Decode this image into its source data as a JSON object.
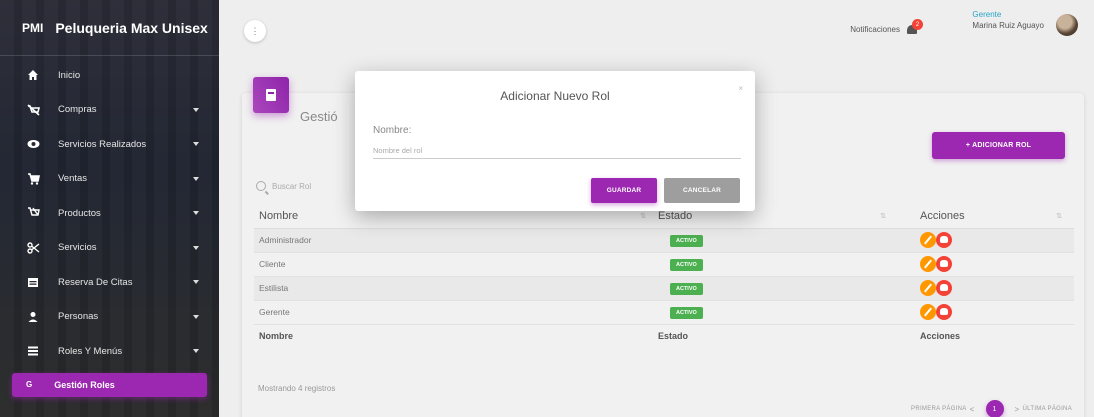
{
  "sidebar": {
    "brand_mini": "PMI",
    "brand_name": "Peluqueria Max Unisex",
    "items": [
      {
        "label": "Inicio",
        "icon": "home-icon",
        "caret": false
      },
      {
        "label": "Compras",
        "icon": "cart-off-icon",
        "caret": true
      },
      {
        "label": "Servicios Realizados",
        "icon": "eye-icon",
        "caret": true
      },
      {
        "label": "Ventas",
        "icon": "shopping-cart-icon",
        "caret": true
      },
      {
        "label": "Productos",
        "icon": "products-icon",
        "caret": true
      },
      {
        "label": "Servicios",
        "icon": "scissors-icon",
        "caret": true
      },
      {
        "label": "Reserva De Citas",
        "icon": "calendar-icon",
        "caret": true
      },
      {
        "label": "Personas",
        "icon": "person-icon",
        "caret": true
      },
      {
        "label": "Roles Y Menús",
        "icon": "list-icon",
        "caret": true
      }
    ],
    "active_item": {
      "mini": "G",
      "label": "Gestión Roles"
    }
  },
  "topbar": {
    "menu_button": "⋮",
    "notifications_label": "Notificaciones",
    "notifications_count": "2",
    "user_role": "Gerente",
    "user_name": "Marina Ruiz Aguayo"
  },
  "card": {
    "title": "Gestió",
    "add_button": "+ ADICIONAR ROL",
    "search_placeholder": "Buscar Rol",
    "columns": [
      "Nombre",
      "Estado",
      "Acciones"
    ],
    "rows": [
      {
        "name": "Administrador",
        "state": "ACTIVO"
      },
      {
        "name": "Cliente",
        "state": "ACTIVO"
      },
      {
        "name": "Estilista",
        "state": "ACTIVO"
      },
      {
        "name": "Gerente",
        "state": "ACTIVO"
      }
    ],
    "footer_columns": [
      "Nombre",
      "Estado",
      "Acciones"
    ],
    "records_text": "Mostrando 4 registros",
    "pager": {
      "first": "PRIMERA PÁGINA",
      "prev": "<",
      "current": "1",
      "next": ">",
      "last": "ÚLTIMA PÁGINA"
    }
  },
  "modal": {
    "title": "Adicionar Nuevo Rol",
    "close": "×",
    "field_label": "Nombre:",
    "field_placeholder": "Nombre del rol",
    "field_value": "",
    "save_button": "GUARDAR",
    "cancel_button": "CANCELAR"
  },
  "colors": {
    "primary": "#9c27b0",
    "success": "#4caf50",
    "warning": "#ff9800",
    "danger": "#f44336",
    "neutral_button": "#9e9e9e"
  }
}
